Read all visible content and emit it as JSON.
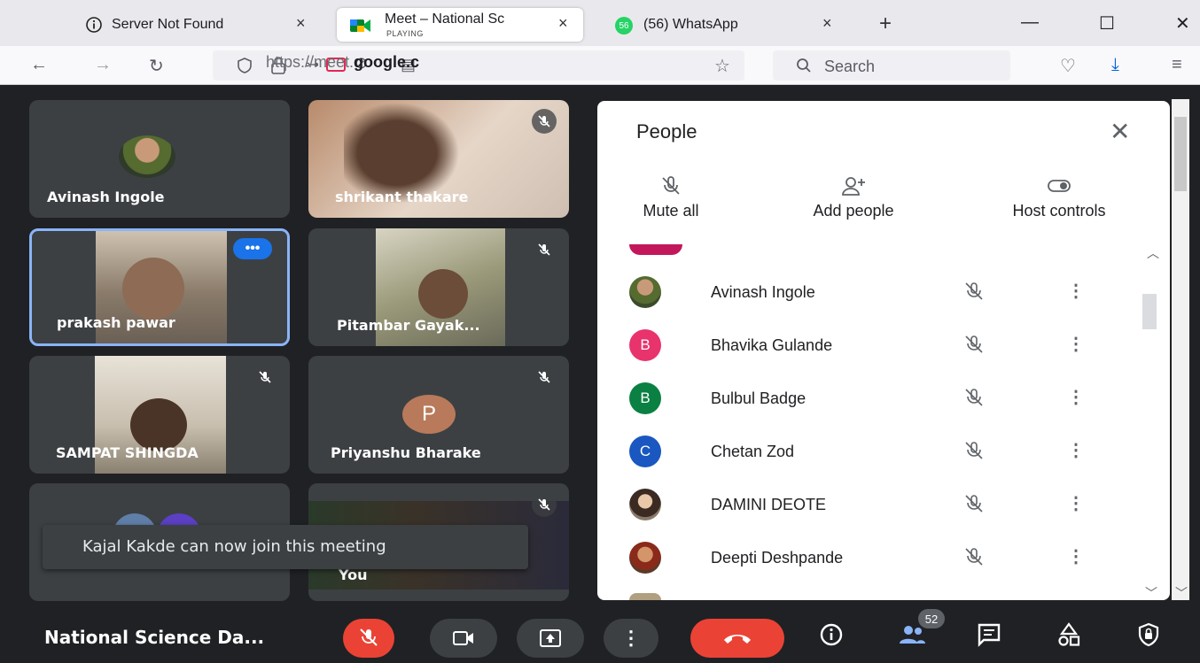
{
  "browser": {
    "tabs": [
      {
        "label": "Server Not Found",
        "close": "×",
        "icon": "info-icon"
      },
      {
        "label": "Meet – National Sc",
        "sublabel": "PLAYING",
        "close": "×",
        "icon": "meet-icon"
      },
      {
        "label": "(56) WhatsApp",
        "badge": "56",
        "close": "×",
        "icon": "whatsapp-icon"
      }
    ],
    "new_tab": "+",
    "window": {
      "minimize": "—",
      "maximize": "☐",
      "close": "✕"
    },
    "url_prefix": "https://meet.",
    "url_domain": "google.c",
    "search_placeholder": "Search"
  },
  "tiles": [
    {
      "name": "Avinash Ingole",
      "kind": "avatar"
    },
    {
      "name": "shrikant thakare",
      "kind": "video",
      "muted": true
    },
    {
      "name": "prakash pawar",
      "kind": "video",
      "selected": true
    },
    {
      "name": "Pitambar Gayak...",
      "kind": "video",
      "muted": true
    },
    {
      "name": "SAMPAT SHINGDA",
      "kind": "video",
      "muted": true
    },
    {
      "name": "Priyanshu Bharake",
      "kind": "letter",
      "letter": "P",
      "muted": true
    },
    {
      "name": "",
      "kind": "avatars"
    },
    {
      "name": "You",
      "kind": "video",
      "muted": true
    }
  ],
  "people_panel": {
    "title": "People",
    "actions": [
      {
        "label": "Mute all",
        "icon": "mic-off-icon"
      },
      {
        "label": "Add people",
        "icon": "add-person-icon"
      },
      {
        "label": "Host controls",
        "icon": "toggle-icon"
      }
    ],
    "participants": [
      {
        "name": "Avinash Ingole",
        "avatar": "photo",
        "color": "#7a8a5a"
      },
      {
        "name": "Bhavika Gulande",
        "avatar": "B",
        "color": "#e8336d"
      },
      {
        "name": "Bulbul Badge",
        "avatar": "B",
        "color": "#0b8043"
      },
      {
        "name": "Chetan Zod",
        "avatar": "C",
        "color": "#1a57c0"
      },
      {
        "name": "DAMINI DEOTE",
        "avatar": "photo",
        "color": "#6b5a4a"
      },
      {
        "name": "Deepti Deshpande",
        "avatar": "photo",
        "color": "#a0522d"
      }
    ]
  },
  "toast": "Kajal Kakde can now join this meeting",
  "bottom_bar": {
    "meeting_title": "National Science Da...",
    "participant_count": "52"
  },
  "colors": {
    "meet_bg": "#202124",
    "tile_bg": "#3c4043",
    "danger": "#ea4335",
    "accent": "#8ab4f8"
  }
}
